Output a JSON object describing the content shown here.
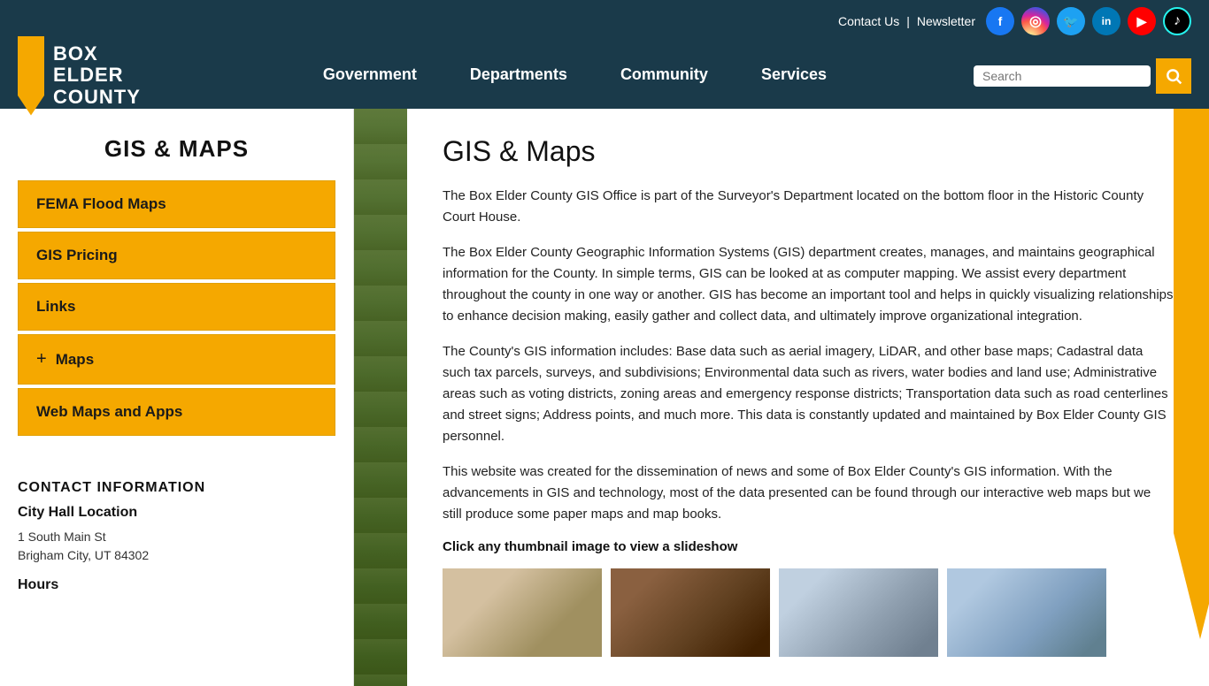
{
  "header": {
    "logo": {
      "line1": "BOX",
      "line2": "ELDER",
      "line3": "COUNTY"
    },
    "top_links": {
      "contact": "Contact Us",
      "divider": "|",
      "newsletter": "Newsletter"
    },
    "social": [
      {
        "name": "facebook",
        "label": "f",
        "class": "si-fb"
      },
      {
        "name": "instagram",
        "label": "📷",
        "class": "si-ig"
      },
      {
        "name": "twitter",
        "label": "🐦",
        "class": "si-tw"
      },
      {
        "name": "linkedin",
        "label": "in",
        "class": "si-li"
      },
      {
        "name": "youtube",
        "label": "▶",
        "class": "si-yt"
      },
      {
        "name": "tiktok",
        "label": "♪",
        "class": "si-tk"
      }
    ],
    "nav": [
      {
        "label": "Government",
        "id": "government"
      },
      {
        "label": "Departments",
        "id": "departments"
      },
      {
        "label": "Community",
        "id": "community"
      },
      {
        "label": "Services",
        "id": "services"
      }
    ],
    "search_placeholder": "Search"
  },
  "sidebar": {
    "title": "GIS & MAPS",
    "menu_items": [
      {
        "label": "FEMA Flood Maps",
        "id": "fema-flood-maps",
        "has_expand": false
      },
      {
        "label": "GIS Pricing",
        "id": "gis-pricing",
        "has_expand": false
      },
      {
        "label": "Links",
        "id": "links",
        "has_expand": false
      },
      {
        "label": "Maps",
        "id": "maps",
        "has_expand": true
      },
      {
        "label": "Web Maps and Apps",
        "id": "web-maps-apps",
        "has_expand": false
      }
    ],
    "contact": {
      "section_title": "CONTACT INFORMATION",
      "location_title": "City Hall Location",
      "address_line1": "1 South Main St",
      "address_line2": "Brigham City, UT 84302",
      "hours_title": "Hours"
    }
  },
  "main": {
    "page_title": "GIS & Maps",
    "paragraphs": [
      "The Box Elder County GIS Office is part of the Surveyor's Department located on the bottom floor in the Historic County Court House.",
      "The Box Elder County Geographic Information Systems (GIS) department creates, manages, and maintains geographical information for the County. In simple terms, GIS can be looked at as computer mapping. We assist every department throughout the county in one way or another. GIS has become an important tool and helps in quickly visualizing relationships to enhance decision making, easily gather and collect data, and ultimately improve organizational integration.",
      "The County's GIS information includes: Base data such as aerial imagery, LiDAR, and other base maps; Cadastral data such tax parcels, surveys, and subdivisions; Environmental data such as rivers, water bodies and land use; Administrative areas such as voting districts, zoning areas and emergency response districts; Transportation data such as road centerlines and street signs; Address points, and much more. This data is constantly updated and maintained by Box Elder County GIS personnel.",
      "This website was created for the dissemination of news and some of Box Elder County's GIS information. With the advancements in GIS and technology, most of the data presented can be found through our interactive web maps but we still produce some paper maps and map books."
    ],
    "thumbnail_label": "Click any thumbnail image to view a slideshow"
  }
}
